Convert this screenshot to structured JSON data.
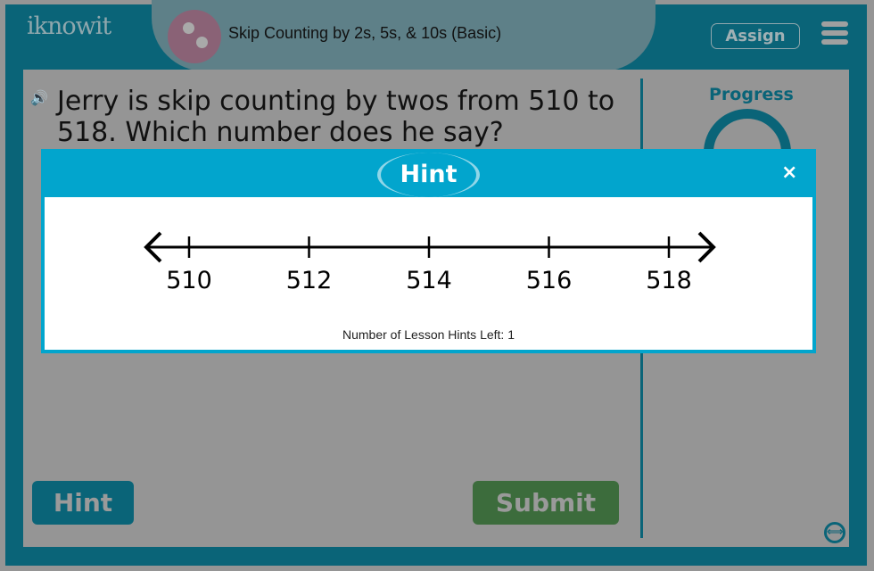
{
  "header": {
    "logo": "iknowit",
    "title": "Skip Counting by 2s, 5s, & 10s (Basic)",
    "assign_label": "Assign",
    "menu_icon": "hamburger-icon"
  },
  "question": {
    "text": "Jerry is skip counting by twos from 510 to 518. Which number does he say?",
    "audio_icon": "speaker-icon"
  },
  "sidebar": {
    "progress_label": "Progress"
  },
  "buttons": {
    "hint": "Hint",
    "submit": "Submit"
  },
  "colors": {
    "frame": "#0a6478",
    "modal_header": "#02a5cd",
    "submit": "#3c6c3c"
  },
  "modal": {
    "title": "Hint",
    "close": "×",
    "number_line": {
      "ticks": [
        "510",
        "512",
        "514",
        "516",
        "518"
      ]
    },
    "hints_left": "Number of Lesson Hints Left: 1"
  }
}
